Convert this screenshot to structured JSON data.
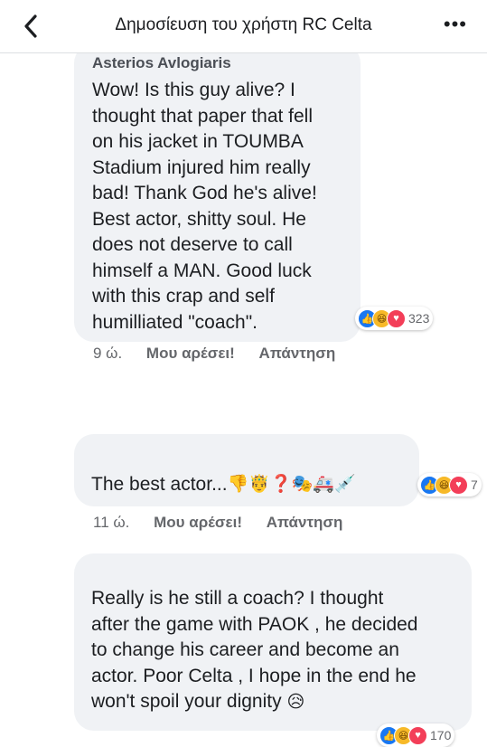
{
  "header": {
    "title": "Δημοσίευση του χρήστη RC Celta",
    "more_glyph": "•••"
  },
  "comments": [
    {
      "author": "Asterios Avlogiaris",
      "lines": [
        "Wow! Is this guy alive? I",
        "thought that paper that fell",
        "on his jacket in TOUMBA",
        "Stadium injured him really",
        "bad! Thank God he's alive!",
        "Best actor, shitty soul. He",
        "does not deserve to call",
        "himself a MAN. Good luck",
        "with this crap and self",
        "humilliated \"coach\"."
      ],
      "reactions": [
        "like",
        "haha",
        "love"
      ],
      "reaction_count": "323",
      "time": "9 ώ.",
      "like_label": "Μου αρέσει!",
      "reply_label": "Απάντηση"
    },
    {
      "text": "The best actor...",
      "emojis": [
        "👎",
        "🤴",
        "❓",
        "🎭",
        "🚑",
        "💉"
      ],
      "reactions": [
        "like",
        "haha",
        "love"
      ],
      "reaction_count": "7",
      "time": "11 ώ.",
      "like_label": "Μου αρέσει!",
      "reply_label": "Απάντηση"
    },
    {
      "lines": [
        "Really is he still a coach?  I thought",
        "after the game with PAOK , he decided",
        "to change his career and become an",
        "actor.  Poor Celta , I hope in the end he",
        "won't spoil your dignity"
      ],
      "trailing_emoji": "😥",
      "reactions": [
        "like",
        "haha",
        "love"
      ],
      "reaction_count": "170"
    }
  ],
  "colors": {
    "bubble": "#f0f2f5",
    "like": "#1877f2",
    "haha": "#f7b928",
    "love": "#f33e58",
    "meta": "#65676b"
  },
  "icons": {
    "back": "chevron-left-icon",
    "more": "more-options-icon"
  }
}
